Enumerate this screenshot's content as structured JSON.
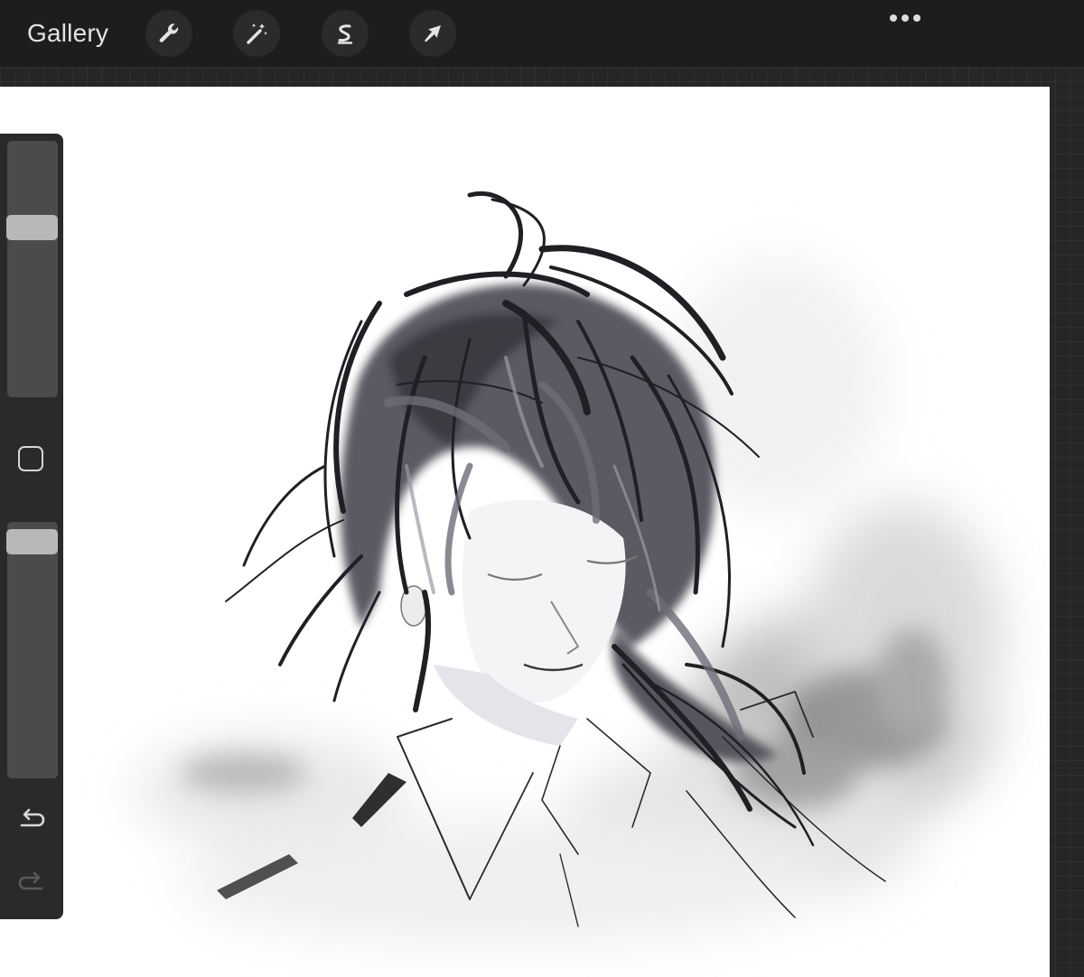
{
  "topbar": {
    "gallery_label": "Gallery",
    "tools": [
      {
        "name": "actions",
        "icon": "wrench-icon"
      },
      {
        "name": "adjustments",
        "icon": "magic-wand-icon"
      },
      {
        "name": "selection",
        "icon": "selection-s-icon"
      },
      {
        "name": "transform",
        "icon": "arrow-cursor-icon"
      }
    ],
    "more_icon": "ellipsis-icon"
  },
  "sidebar": {
    "brush_size": 0.68,
    "opacity": 0.97,
    "modify_icon": "square-outline-icon",
    "undo_icon": "undo-icon",
    "redo_icon": "redo-icon",
    "redo_enabled": false
  },
  "canvas": {
    "content": "ink-sketch-artwork",
    "background": "#ffffff"
  },
  "colors": {
    "toolbar_bg": "#1d1d1d",
    "sidebar_bg": "#2a2a2a",
    "icon": "#e3e3e3",
    "thumb": "#b8b8b8"
  }
}
